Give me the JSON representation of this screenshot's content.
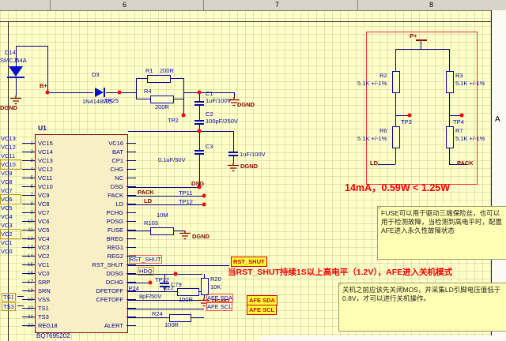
{
  "window": {
    "ruler_cols": [
      "6",
      "7",
      "8"
    ],
    "zone_row_label": "A"
  },
  "ic": {
    "refdes": "U1",
    "part_number": "BQ7695202",
    "pin_numbers_left": [
      "1",
      "2",
      "3",
      "4",
      "5",
      "6",
      "7",
      "8",
      "9",
      "10",
      "11",
      "12",
      "13",
      "14",
      "15",
      "16",
      "17",
      "18",
      "19",
      "20",
      "21",
      "22"
    ],
    "pins_left": [
      "VC15",
      "VC14",
      "VC13",
      "VC12",
      "VC11",
      "VC10",
      "VC9",
      "VC8",
      "VC7",
      "VC6",
      "VC5",
      "VC4",
      "VC3",
      "VC2",
      "VC1",
      "VC0",
      "SRP",
      "SRN",
      "VSS",
      "TS1",
      "TS3",
      "REG18"
    ],
    "pins_right": [
      "VC16",
      "BAT",
      "CP1",
      "CHG",
      "NC",
      "DSG",
      "PACK",
      "LD",
      "PCHG",
      "PDSG",
      "FUSE",
      "BREG",
      "REG1",
      "REG2",
      "RST_SHUT",
      "DDSG",
      "DCHG",
      "DFETOFF",
      "CFETOFF",
      "",
      "",
      "ALERT"
    ]
  },
  "net_labels_left": [
    "VC13",
    "VC12",
    "VC11",
    "VC10",
    "VC9",
    "VC8",
    "VC7",
    "VC6",
    "VC5",
    "VC4",
    "VC3",
    "VC2",
    "VC1",
    "VC0"
  ],
  "net_labels_bottom": {
    "ts1": "TS1",
    "ts3": "TS3"
  },
  "components": {
    "d14": {
      "ref": "D14",
      "value": "SMCJ54A"
    },
    "d3": {
      "ref": "D3",
      "value": "1N4148WS"
    },
    "r1": {
      "ref": "R1",
      "value": "200R"
    },
    "r4": {
      "ref": "R4",
      "value": "200R"
    },
    "r103": {
      "ref": "R103",
      "value": "10M"
    },
    "r20": {
      "ref": "R20",
      "value": "10K"
    },
    "r22": {
      "ref": "R22",
      "value": "100R"
    },
    "r24": {
      "ref": "R24",
      "value": "100R"
    },
    "c1": {
      "ref": "C1",
      "value": "1uF/100V"
    },
    "c2": {
      "ref": "C2",
      "value": "100pF/250V"
    },
    "c3": {
      "ref": "C3",
      "value": "0.1uF/50V"
    },
    "c4": {
      "value": "1uF/100V"
    },
    "c79": {
      "ref": "C79",
      "value": "8pF/50V"
    },
    "r2": {
      "ref": "R2",
      "value": "5.1K +/-1%"
    },
    "r3": {
      "ref": "R3",
      "value": "5.1K +/-1%"
    },
    "r6": {
      "ref": "R6",
      "value": "5.1K +/-1%"
    },
    "r7": {
      "ref": "R7",
      "value": "5.1K +/-1%"
    }
  },
  "test_points": {
    "tp25": "TP25",
    "tp2": "TP2",
    "tp11": "TP11",
    "tp12": "TP12",
    "tp22": "TP22",
    "tp24": "TP24",
    "tp3": "TP3",
    "tp4": "TP4"
  },
  "power_labels": {
    "b_plus": "B+",
    "p_plus": "P+",
    "dgnd": "DGND"
  },
  "net_flags": {
    "dsg": "DSG",
    "pack": "PACK",
    "ld": "LD",
    "rst_shut": "RST_SHUT",
    "hdq": "HDQ",
    "afe_sda": "AFE SDA",
    "afe_scl": "AFE SCL"
  },
  "annotations": {
    "power_note": "14mA，0.59W < 1.25W",
    "fuse_note": "FUSE可以用于驱动三端保险丝，也可以用于检测故障，当检测到高电平时，配置AFE进入永久性故障状态",
    "rst_note": "当RST_SHUT持续1S以上高电平（1.2V），AFE进入关机模式",
    "shutdown_note": "关机之前应该先关闭MOS，并采集LD引脚电压值低于0.8V，才可以进行关机操作。"
  },
  "colors": {
    "canvas": "#FFFFC9",
    "wire": "#00008B",
    "component_text": "#0808A8",
    "power_text": "#8B0000",
    "highlight_bg": "#FFFF3C",
    "highlight_text": "#D40000",
    "testpoint": "#FF0000",
    "note_bg": "#FFFFB4"
  }
}
